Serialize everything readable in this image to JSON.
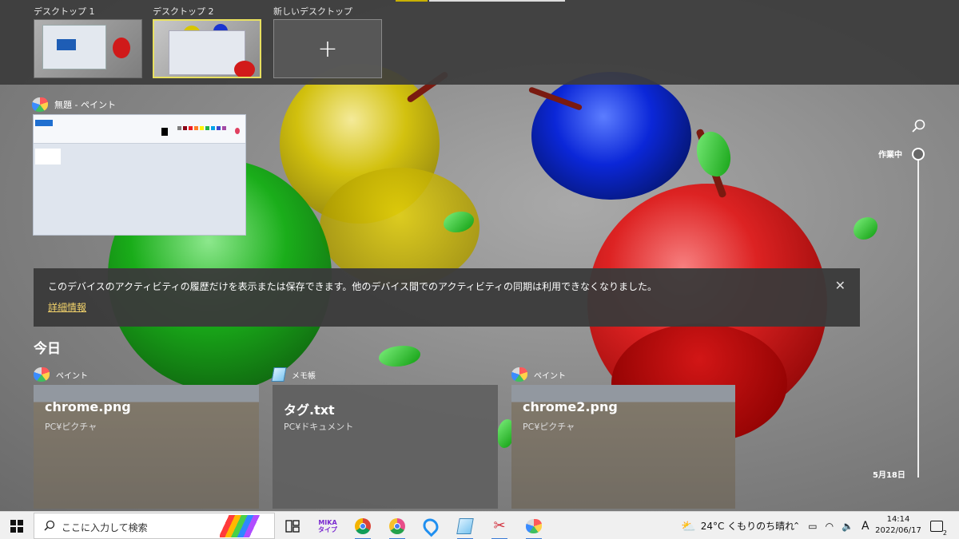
{
  "desktops": [
    {
      "label": "デスクトップ 1",
      "active": false
    },
    {
      "label": "デスクトップ 2",
      "active": true
    },
    {
      "label": "新しいデスクトップ",
      "is_new": true,
      "symbol": "+"
    }
  ],
  "window_group": {
    "app_title": "無題 - ペイント",
    "icon": "paint-icon"
  },
  "notice": {
    "text": "このデバイスのアクティビティの履歴だけを表示または保存できます。他のデバイス間でのアクティビティの同期は利用できなくなりました。",
    "link": "詳細情報",
    "close_symbol": "✕"
  },
  "timeline": {
    "top_label": "作業中",
    "bottom_label": "5月18日"
  },
  "today": {
    "heading": "今日",
    "cards": [
      {
        "app": "ペイント",
        "icon": "paint-icon",
        "title": "chrome.png",
        "path": "PC¥ピクチャ"
      },
      {
        "app": "メモ帳",
        "icon": "notepad-icon",
        "title": "タグ.txt",
        "path": "PC¥ドキュメント"
      },
      {
        "app": "ペイント",
        "icon": "paint-icon",
        "title": "chrome2.png",
        "path": "PC¥ピクチャ"
      }
    ]
  },
  "taskbar": {
    "search_placeholder": "ここに入力して検索",
    "pinned": [
      "task-view-icon",
      "mika-type-icon",
      "chrome-icon",
      "chrome-alt-icon",
      "cortana-icon",
      "notepad-taskbar-icon",
      "snipping-icon",
      "paint-taskbar-icon"
    ],
    "mika_label": "MIKA\nタイプ",
    "weather": "24°C くもりのち晴れ",
    "ime": "A",
    "time": "14:14",
    "date": "2022/06/17",
    "notification_count": "2"
  },
  "colors": {
    "active_desktop_border": "#e8e060",
    "link_color": "#f3d36b",
    "taskbar_bg": "#f0f0f0"
  }
}
